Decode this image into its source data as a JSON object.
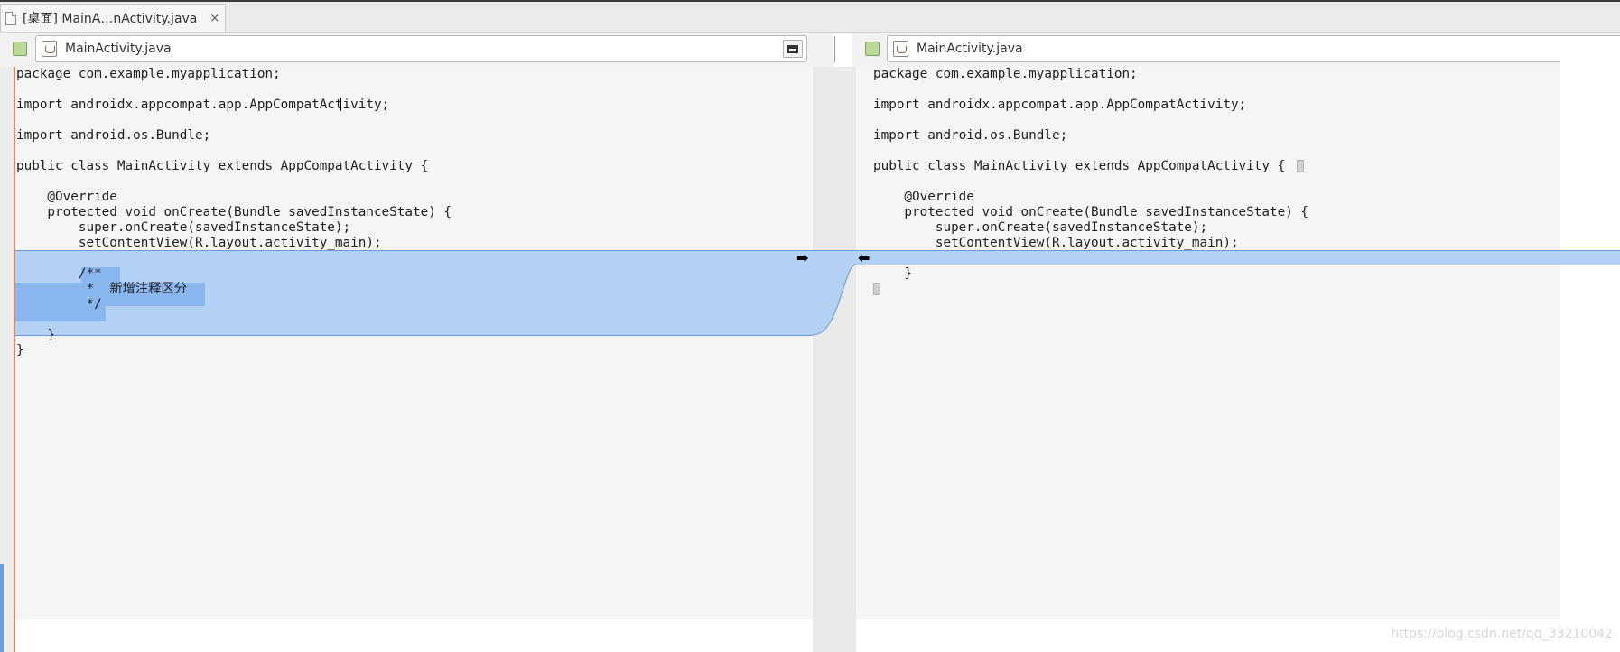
{
  "tab": {
    "label": "[桌面] MainA…nActivity.java",
    "close": "×"
  },
  "left_file": {
    "name": "MainActivity.java"
  },
  "right_file": {
    "name": "MainActivity.java"
  },
  "left_code": [
    "package com.example.myapplication;",
    "",
    "import androidx.appcompat.app.AppCompatActivity;",
    "",
    "import android.os.Bundle;",
    "",
    "public class MainActivity extends AppCompatActivity {",
    "",
    "    @Override",
    "    protected void onCreate(Bundle savedInstanceState) {",
    "        super.onCreate(savedInstanceState);",
    "        setContentView(R.layout.activity_main);",
    "",
    "        /**",
    "         *  新增注释区分",
    "         */",
    "",
    "    }",
    "}"
  ],
  "right_code": [
    "package com.example.myapplication;",
    "",
    "import androidx.appcompat.app.AppCompatActivity;",
    "",
    "import android.os.Bundle;",
    "",
    "public class MainActivity extends AppCompatActivity {",
    "",
    "    @Override",
    "    protected void onCreate(Bundle savedInstanceState) {",
    "        super.onCreate(savedInstanceState);",
    "        setContentView(R.layout.activity_main);",
    "",
    "    }",
    ""
  ],
  "merge_right_arrow": "➡",
  "merge_left_arrow": "⬅",
  "watermark": "https://blog.csdn.net/qq_33210042",
  "colors": {
    "change_fill": "#b3d1f5",
    "selection": "#89b6ef",
    "accent_line": "#e7864f"
  }
}
